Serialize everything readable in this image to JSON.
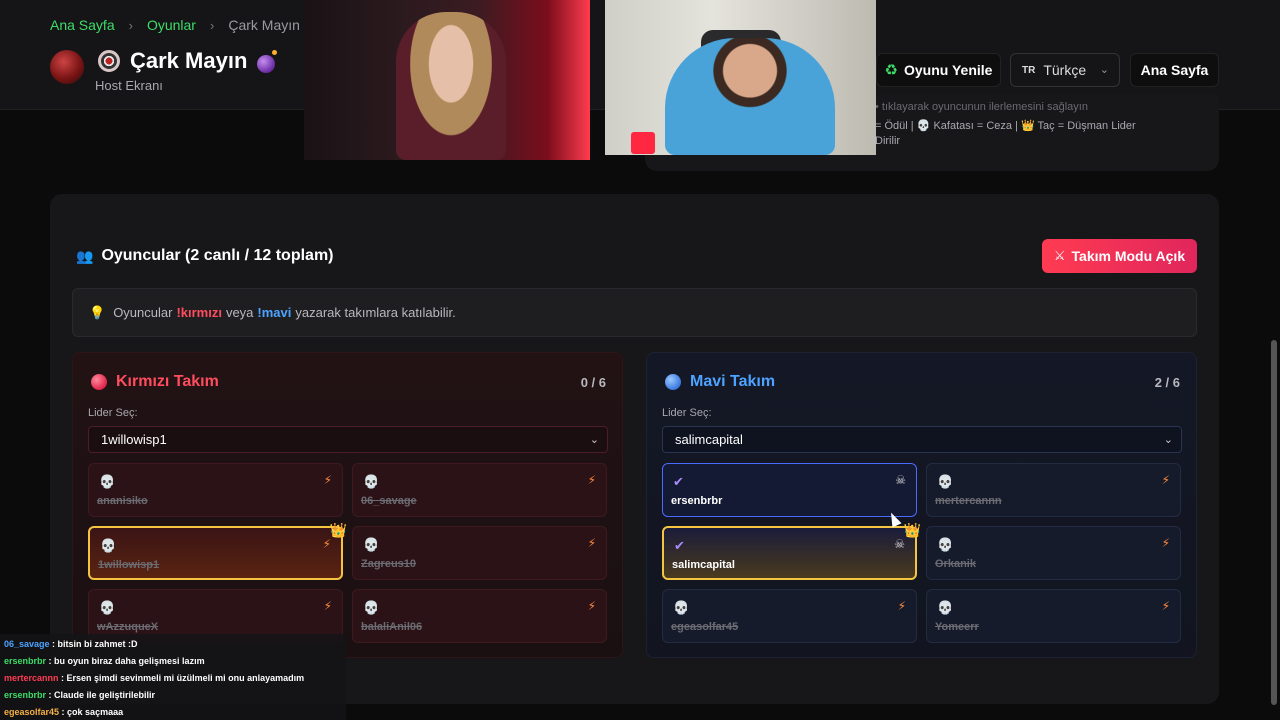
{
  "breadcrumb": {
    "home": "Ana Sayfa",
    "sep": "›",
    "games": "Oyunlar",
    "current": "Çark Mayın"
  },
  "header": {
    "title": "Çark Mayın",
    "subtitle": "Host Ekranı",
    "refresh_label": "Oyunu Yenile",
    "lang_flag": "TR",
    "lang_label": "Türkçe",
    "home_label": "Ana Sayfa"
  },
  "info": {
    "line1": "• tıklayarak oyuncunun ilerlemesini sağlayın",
    "line2": "= Ödül | 💀 Kafatası = Ceza | 👑 Taç = Düşman Lider Dirilir"
  },
  "players": {
    "title": "Oyuncular (2 canlı / 12 toplam)",
    "team_mode_label": "Takım Modu Açık",
    "tip_prefix": "Oyuncular",
    "tip_red": "!kırmızı",
    "tip_mid": "veya",
    "tip_blue": "!mavi",
    "tip_suffix": "yazarak takımlara katılabilir."
  },
  "teams": {
    "red": {
      "name": "Kırmızı Takım",
      "count": "0 / 6",
      "leader_label": "Lider Seç:",
      "leader_value": "1willowisp1",
      "players": [
        {
          "name": "ananisiko",
          "state": "dead"
        },
        {
          "name": "06_savage",
          "state": "dead"
        },
        {
          "name": "1willowisp1",
          "state": "dead",
          "leader": true
        },
        {
          "name": "Zagreus10",
          "state": "dead"
        },
        {
          "name": "wAzzuqueX",
          "state": "dead"
        },
        {
          "name": "balaliAnil06",
          "state": "dead"
        }
      ]
    },
    "blue": {
      "name": "Mavi Takım",
      "count": "2 / 6",
      "leader_label": "Lider Seç:",
      "leader_value": "salimcapital",
      "players": [
        {
          "name": "ersenbrbr",
          "state": "alive"
        },
        {
          "name": "mertercannn",
          "state": "dead"
        },
        {
          "name": "salimcapital",
          "state": "alive",
          "leader": true
        },
        {
          "name": "Orkanik",
          "state": "dead"
        },
        {
          "name": "egeasolfar45",
          "state": "dead"
        },
        {
          "name": "Yomeerr",
          "state": "dead"
        }
      ]
    }
  },
  "chat": [
    {
      "user": "06_savage",
      "color": "#4da3ff",
      "text": ": bitsin bi zahmet :D"
    },
    {
      "user": "ersenbrbr",
      "color": "#3ddc68",
      "text": ": bu oyun biraz daha gelişmesi lazım"
    },
    {
      "user": "mertercannn",
      "color": "#ff3b52",
      "text": ": Ersen şimdi sevinmeli mi üzülmeli mi onu anlayamadım"
    },
    {
      "user": "ersenbrbr",
      "color": "#3ddc68",
      "text": ": Claude ile geliştirilebilir"
    },
    {
      "user": "egeasolfar45",
      "color": "#f5b042",
      "text": ": çok saçmaaa"
    }
  ],
  "icons": {
    "skull": "💀",
    "bolt": "⚡",
    "check": "✔",
    "crossbones": "☠",
    "crown": "👑",
    "refresh": "♻",
    "bulb": "💡",
    "people": "👥",
    "swords": "⚔"
  }
}
